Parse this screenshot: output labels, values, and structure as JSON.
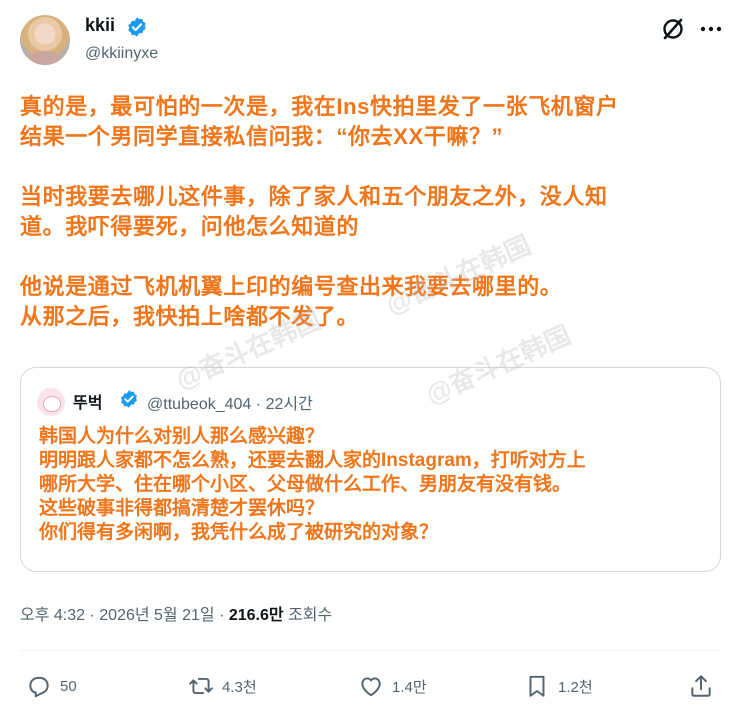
{
  "author": {
    "name": "kkii",
    "handle": "@kkiinyxe"
  },
  "tweet": {
    "lines": [
      "真的是，最可怕的一次是，我在Ins快拍里发了一张飞机窗户",
      "结果一个男同学直接私信问我：“你去XX干嘛？”",
      "",
      "当时我要去哪儿这件事，除了家人和五个朋友之外，没人知",
      "道。我吓得要死，问他怎么知道的",
      "",
      "他说是通过飞机机翼上印的编号查出来我要去哪里的。",
      "从那之后，我快拍上啥都不发了。"
    ]
  },
  "quote": {
    "name": "뚜벅",
    "handle": "@ttubeok_404",
    "time": "22시간",
    "lines": [
      "韩国人为什么对别人那么感兴趣？",
      "明明跟人家都不怎么熟，还要去翻人家的Instagram，打听对方上",
      "哪所大学、住在哪个小区、父母做什么工作、男朋友有没有钱。",
      "这些破事非得都搞清楚才罢休吗？",
      "你们得有多闲啊，我凭什么成了被研究的对象？"
    ]
  },
  "meta": {
    "time": "오후 4:32",
    "date": "2026년 5월 21일",
    "views": "216.6만",
    "views_label": "조회수"
  },
  "actions": {
    "reply_count": "50",
    "retweet_count": "4.3천",
    "like_count": "1.4만",
    "bookmark_count": "1.2천"
  },
  "watermark": {
    "text": "@奋斗在韩国"
  },
  "colors": {
    "accent_text": "#f0761b",
    "verified": "#1d9bf0",
    "secondary_text": "#536471"
  }
}
